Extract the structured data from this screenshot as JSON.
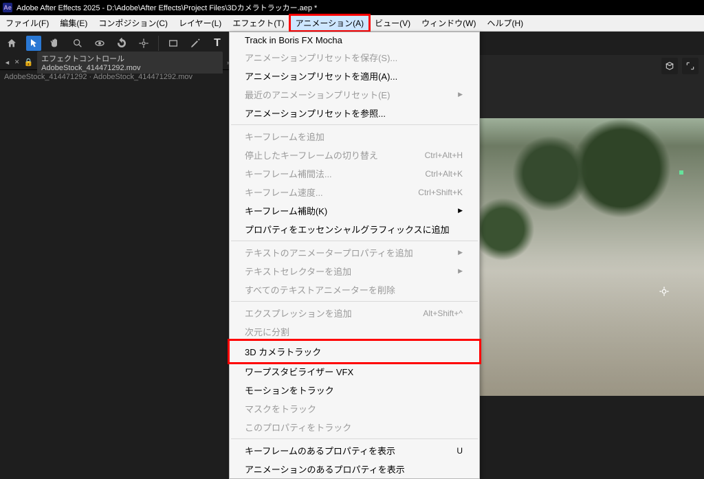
{
  "title": "Adobe After Effects 2025 - D:\\Adobe\\After Effects\\Project Files\\3Dカメラトラッカー.aep *",
  "app_icon_text": "Ae",
  "menu": {
    "file": "ファイル(F)",
    "edit": "編集(E)",
    "comp": "コンポジション(C)",
    "layer": "レイヤー(L)",
    "effect": "エフェクト(T)",
    "anim": "アニメーション(A)",
    "view": "ビュー(V)",
    "window": "ウィンドウ(W)",
    "help": "ヘルプ(H)"
  },
  "panel": {
    "tab_label": "エフェクトコントロール AdobeStock_414471292.mov",
    "breadcrumb": "AdobeStock_414471292 · AdobeStock_414471292.mov"
  },
  "dropdown": [
    {
      "label": "Track in Boris FX Mocha",
      "enabled": true
    },
    {
      "label": "アニメーションプリセットを保存(S)...",
      "enabled": false
    },
    {
      "label": "アニメーションプリセットを適用(A)...",
      "enabled": true
    },
    {
      "label": "最近のアニメーションプリセット(E)",
      "enabled": false,
      "submenu": true
    },
    {
      "label": "アニメーションプリセットを参照...",
      "enabled": true
    },
    {
      "sep": true
    },
    {
      "label": "キーフレームを追加",
      "enabled": false
    },
    {
      "label": "停止したキーフレームの切り替え",
      "enabled": false,
      "shortcut": "Ctrl+Alt+H"
    },
    {
      "label": "キーフレーム補間法...",
      "enabled": false,
      "shortcut": "Ctrl+Alt+K"
    },
    {
      "label": "キーフレーム速度...",
      "enabled": false,
      "shortcut": "Ctrl+Shift+K"
    },
    {
      "label": "キーフレーム補助(K)",
      "enabled": true,
      "submenu": true
    },
    {
      "label": "プロパティをエッセンシャルグラフィックスに追加",
      "enabled": true
    },
    {
      "sep": true
    },
    {
      "label": "テキストのアニメータープロパティを追加",
      "enabled": false,
      "submenu": true
    },
    {
      "label": "テキストセレクターを追加",
      "enabled": false,
      "submenu": true
    },
    {
      "label": "すべてのテキストアニメーターを削除",
      "enabled": false
    },
    {
      "sep": true
    },
    {
      "label": "エクスプレッションを追加",
      "enabled": false,
      "shortcut": "Alt+Shift+^"
    },
    {
      "label": "次元に分割",
      "enabled": false
    },
    {
      "label": "3D カメラトラック",
      "enabled": true,
      "highlight": true
    },
    {
      "label": "ワープスタビライザー VFX",
      "enabled": true
    },
    {
      "label": "モーションをトラック",
      "enabled": true
    },
    {
      "label": "マスクをトラック",
      "enabled": false
    },
    {
      "label": "このプロパティをトラック",
      "enabled": false
    },
    {
      "sep": true
    },
    {
      "label": "キーフレームのあるプロパティを表示",
      "enabled": true,
      "shortcut": "U"
    },
    {
      "label": "アニメーションのあるプロパティを表示",
      "enabled": true
    }
  ]
}
